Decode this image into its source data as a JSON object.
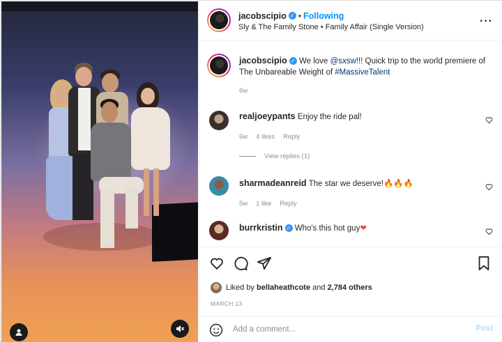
{
  "post": {
    "username": "jacobscipio",
    "follow_status": "Following",
    "audio": "Sly & The Family Stone • Family Affair (Single Version)",
    "caption": {
      "text_pre": "We love ",
      "mention": "@sxsw",
      "text_mid": "!!! Quick trip to the world premiere of The Unbareable Weight of ",
      "hashtag": "#MassiveTalent",
      "time": "6w"
    }
  },
  "comments": [
    {
      "username": "realjoeypants",
      "text": "Enjoy the ride pal!",
      "time": "6w",
      "likes": "4 likes",
      "reply_label": "Reply",
      "view_replies": "View replies (1)"
    },
    {
      "username": "sharmadeanreid",
      "text": "The star we deserve!🔥🔥🔥",
      "time": "5w",
      "likes": "1 like",
      "reply_label": "Reply"
    },
    {
      "username": "burrkristin",
      "verified": true,
      "text": "Who's this hot guy",
      "heart_emoji": "❤"
    }
  ],
  "likes": {
    "prefix": "Liked by",
    "liker": "bellaheathcote",
    "conj": "and",
    "count": "2,784 others"
  },
  "date": "MARCH 13",
  "comment_box": {
    "placeholder": "Add a comment...",
    "post_label": "Post"
  },
  "icons": {
    "more": "more-options-icon",
    "like": "heart-icon",
    "comment": "comment-icon",
    "share": "share-icon",
    "save": "bookmark-icon",
    "emoji": "emoji-icon",
    "tagged": "user-tag-icon",
    "audio": "audio-muted-icon",
    "verified": "verified-badge-icon"
  },
  "colors": {
    "accent": "#0095f6",
    "verified": "#3897f0",
    "post_disabled": "#b2dffc",
    "heart": "#ed4956"
  }
}
